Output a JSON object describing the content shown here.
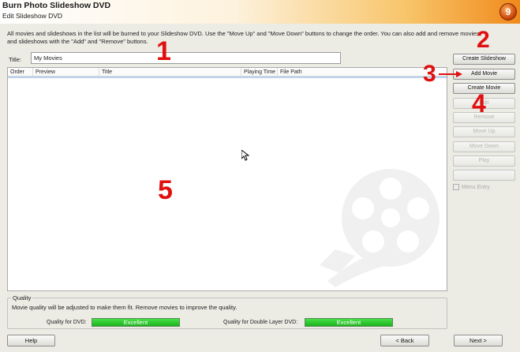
{
  "window": {
    "app_title": "Burn Photo Slideshow DVD",
    "subtitle": "Edit Slideshow DVD",
    "logo_text": "9"
  },
  "instructions": "All movies and slideshows in the list will be burned to your Slideshow DVD. Use the \"Move Up\" and \"Move Down\" buttons to change the order. You can also add and remove movies and slideshows with the \"Add\" and \"Remove\" buttons.",
  "title_field": {
    "label": "Title:",
    "value": "My Movies"
  },
  "list": {
    "columns": [
      "Order",
      "Preview",
      "Title",
      "Playing Time",
      "File Path"
    ],
    "rows": []
  },
  "buttons": {
    "create_slideshow": "Create Slideshow",
    "add_movie": "Add Movie",
    "create_movie": "Create Movie",
    "edit": "Edit",
    "remove": "Remove",
    "move_up": "Move Up",
    "move_down": "Move Down",
    "play": "Play"
  },
  "menu_entry": {
    "label": "Menu Entry",
    "checked": false
  },
  "quality": {
    "legend": "Quality",
    "note": "Movie quality will be adjusted to make them fit. Remove movies to improve the quality.",
    "dvd_label": "Quality for DVD:",
    "dvd_value": "Excellent",
    "dl_label": "Quality for Double Layer DVD:",
    "dl_value": "Excellent",
    "bar_color": "#2ccb2c"
  },
  "nav": {
    "help": "Help",
    "back": "< Back",
    "next": "Next >"
  },
  "annotations": [
    "1",
    "2",
    "3",
    "4",
    "5"
  ],
  "annotation_color": "#e01010"
}
